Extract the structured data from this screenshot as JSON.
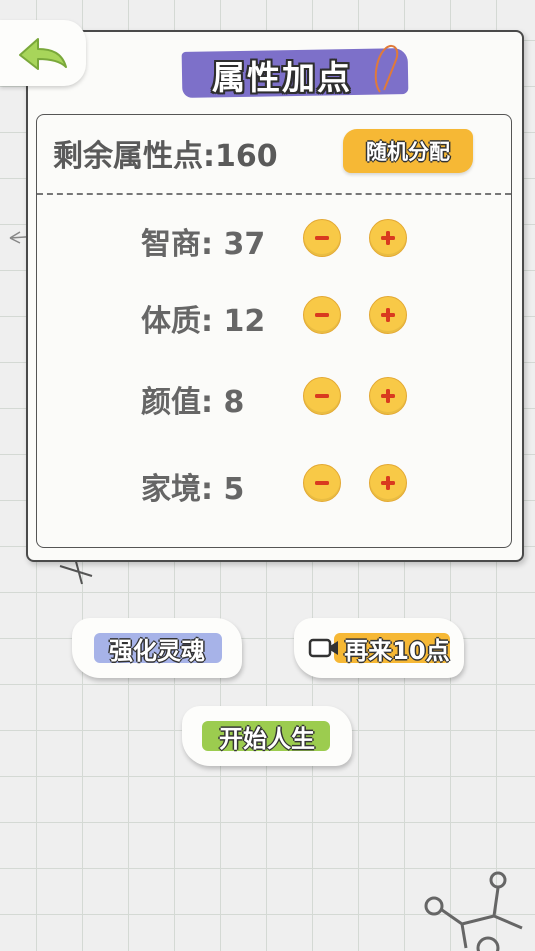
{
  "header": {
    "title": "属性加点",
    "back_icon": "arrow-back-icon"
  },
  "points": {
    "label": "剩余属性点",
    "colon": ":",
    "value": "160"
  },
  "random_button": {
    "label": "随机分配"
  },
  "attributes": [
    {
      "label": "智商",
      "colon": ":",
      "value": "37"
    },
    {
      "label": "体质",
      "colon": ":",
      "value": "12"
    },
    {
      "label": "颜值",
      "colon": ":",
      "value": "8"
    },
    {
      "label": "家境",
      "colon": ":",
      "value": "5"
    }
  ],
  "buttons": {
    "strengthen_soul": "强化灵魂",
    "more_points": "再来10点",
    "start_life": "开始人生"
  },
  "colors": {
    "title_bg": "#7d70c9",
    "accent_yellow": "#f6b835",
    "soul_highlight": "#a7b3e8",
    "start_highlight": "#9ccc4f",
    "back_arrow": "#a8d55a",
    "grid_line": "#d4d9d4"
  }
}
